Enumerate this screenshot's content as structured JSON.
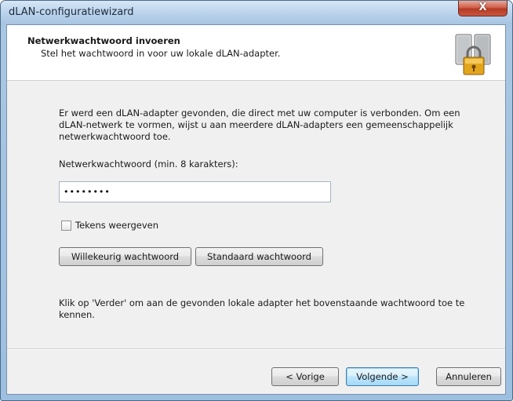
{
  "window": {
    "title": "dLAN-configuratiewizard",
    "close_glyph": "X"
  },
  "header": {
    "title": "Netwerkwachtwoord invoeren",
    "subtitle": "Stel het wachtwoord in voor uw lokale dLAN-adapter.",
    "icon": "lock-adapter-icon"
  },
  "body": {
    "description": "Er werd een dLAN-adapter gevonden, die direct met uw computer is verbonden. Om een dLAN-netwerk te vormen, wijst u aan meerdere dLAN-adapters een gemeenschappelijk netwerkwachtwoord toe.",
    "password_label": "Netwerkwachtwoord (min. 8 karakters):",
    "password_value": "••••••••",
    "show_chars_label": "Tekens weergeven",
    "show_chars_checked": false,
    "random_button": "Willekeurig wachtwoord",
    "standard_button": "Standaard wachtwoord",
    "info": "Klik op 'Verder' om aan de gevonden lokale adapter het bovenstaande wachtwoord toe te kennen."
  },
  "footer": {
    "back_button": "< Vorige",
    "next_button": "Volgende >",
    "cancel_button": "Annuleren"
  }
}
